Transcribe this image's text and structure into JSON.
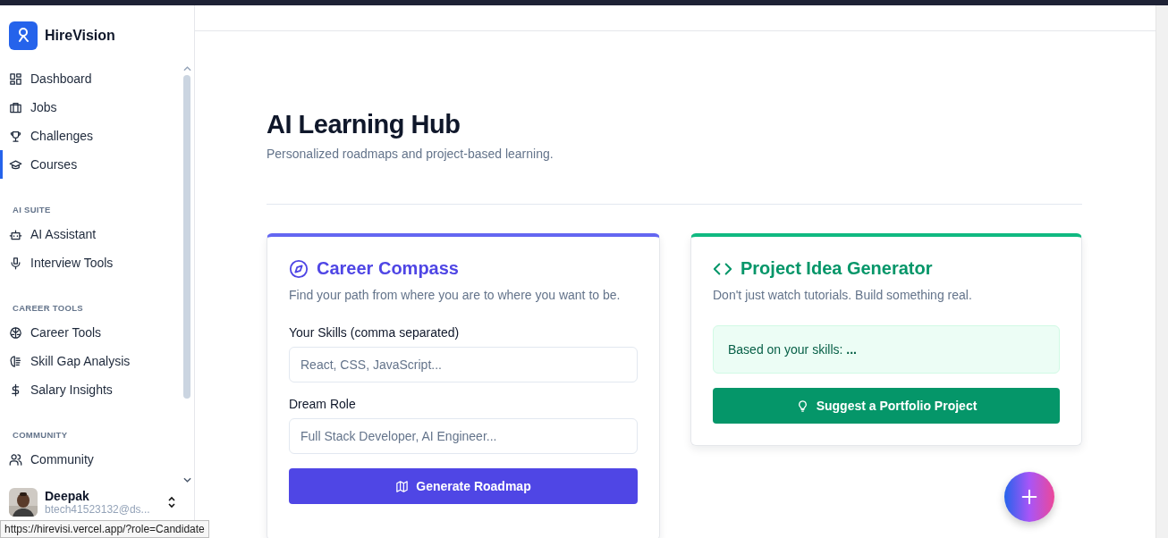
{
  "sidebar": {
    "brand": "HireVision",
    "sections": [
      {
        "items": [
          {
            "label": "Dashboard",
            "selected": false
          },
          {
            "label": "Jobs",
            "selected": false
          },
          {
            "label": "Challenges",
            "selected": false
          },
          {
            "label": "Courses",
            "selected": true
          }
        ]
      },
      {
        "heading": "AI SUITE",
        "items": [
          {
            "label": "AI Assistant",
            "selected": false
          },
          {
            "label": "Interview Tools",
            "selected": false
          }
        ]
      },
      {
        "heading": "CAREER TOOLS",
        "items": [
          {
            "label": "Career Tools",
            "selected": false
          },
          {
            "label": "Skill Gap Analysis",
            "selected": false
          },
          {
            "label": "Salary Insights",
            "selected": false
          }
        ]
      },
      {
        "heading": "COMMUNITY",
        "items": [
          {
            "label": "Community",
            "selected": false
          }
        ]
      }
    ],
    "user": {
      "name": "Deepak",
      "email": "btech41523132@ds..."
    }
  },
  "page": {
    "title": "AI Learning Hub",
    "subtitle": "Personalized roadmaps and project-based learning."
  },
  "career_compass": {
    "title": "Career Compass",
    "description": "Find your path from where you are to where you want to be.",
    "fields": [
      {
        "label": "Your Skills (comma separated)",
        "placeholder": "React, CSS, JavaScript..."
      },
      {
        "label": "Dream Role",
        "placeholder": "Full Stack Developer, AI Engineer..."
      }
    ],
    "button": "Generate Roadmap"
  },
  "project_generator": {
    "title": "Project Idea Generator",
    "description": "Don't just watch tutorials. Build something real.",
    "note": "Based on your skills: **...**",
    "button": "Suggest a Portfolio Project"
  },
  "status_link": "https://hirevisi.vercel.app/?role=Candidate"
}
